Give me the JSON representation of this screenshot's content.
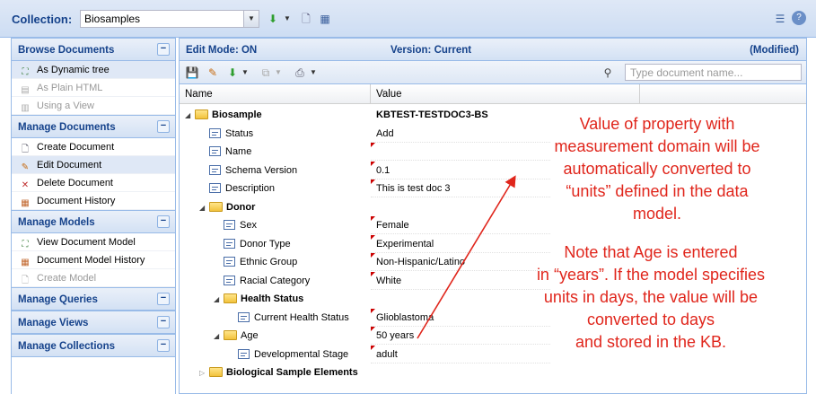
{
  "collection": {
    "label": "Collection:",
    "selected": "Biosamples"
  },
  "left_panel": {
    "sections": [
      {
        "title": "Browse Documents",
        "items": [
          {
            "label": "As Dynamic tree",
            "icon": "tree-icon",
            "state": "selected"
          },
          {
            "label": "As Plain HTML",
            "icon": "html-icon",
            "state": "disabled"
          },
          {
            "label": "Using a View",
            "icon": "view-icon",
            "state": "disabled"
          }
        ]
      },
      {
        "title": "Manage Documents",
        "items": [
          {
            "label": "Create Document",
            "icon": "new-document-icon",
            "state": "normal"
          },
          {
            "label": "Edit Document",
            "icon": "edit-document-icon",
            "state": "selected"
          },
          {
            "label": "Delete Document",
            "icon": "delete-document-icon",
            "state": "normal"
          },
          {
            "label": "Document History",
            "icon": "history-icon",
            "state": "normal"
          }
        ]
      },
      {
        "title": "Manage Models",
        "items": [
          {
            "label": "View Document Model",
            "icon": "tree-icon",
            "state": "normal"
          },
          {
            "label": "Document Model History",
            "icon": "history-icon",
            "state": "normal"
          },
          {
            "label": "Create Model",
            "icon": "new-document-icon",
            "state": "disabled"
          }
        ]
      },
      {
        "title": "Manage Queries",
        "items": []
      },
      {
        "title": "Manage Views",
        "items": []
      },
      {
        "title": "Manage Collections",
        "items": []
      }
    ],
    "toggle_symbol": "−"
  },
  "editor": {
    "mode": "Edit Mode: ON",
    "version": "Version: Current",
    "status": "(Modified)",
    "search_placeholder": "Type document name...",
    "columns": {
      "name": "Name",
      "value": "Value"
    },
    "rows": [
      {
        "name": "Biosample",
        "value": "KBTEST-TESTDOC3-BS",
        "kind": "folder",
        "depth": 0,
        "expanded": true,
        "bold_value": true
      },
      {
        "name": "Status",
        "value": "Add",
        "kind": "prop",
        "depth": 1,
        "dirty": false
      },
      {
        "name": "Name",
        "value": "",
        "kind": "prop",
        "depth": 1,
        "dirty": true
      },
      {
        "name": "Schema Version",
        "value": "0.1",
        "kind": "prop",
        "depth": 1,
        "dirty": true
      },
      {
        "name": "Description",
        "value": "This is test doc 3",
        "kind": "prop",
        "depth": 1,
        "dirty": true
      },
      {
        "name": "Donor",
        "value": "",
        "kind": "folder",
        "depth": 1,
        "expanded": true
      },
      {
        "name": "Sex",
        "value": "Female",
        "kind": "prop",
        "depth": 2,
        "dirty": true
      },
      {
        "name": "Donor Type",
        "value": "Experimental",
        "kind": "prop",
        "depth": 2,
        "dirty": true
      },
      {
        "name": "Ethnic Group",
        "value": "Non-Hispanic/Latino",
        "kind": "prop",
        "depth": 2,
        "dirty": true
      },
      {
        "name": "Racial Category",
        "value": "White",
        "kind": "prop",
        "depth": 2,
        "dirty": true
      },
      {
        "name": "Health Status",
        "value": "",
        "kind": "folder",
        "depth": 2,
        "expanded": true
      },
      {
        "name": "Current Health Status",
        "value": "Glioblastoma",
        "kind": "prop",
        "depth": 3,
        "dirty": true
      },
      {
        "name": "Age",
        "value": "50 years",
        "kind": "folder",
        "depth": 2,
        "expanded": true,
        "dirty": true
      },
      {
        "name": "Developmental Stage",
        "value": "adult",
        "kind": "prop",
        "depth": 3,
        "dirty": true
      },
      {
        "name": "Biological Sample Elements",
        "value": "",
        "kind": "folder",
        "depth": 1,
        "expanded": false
      }
    ]
  },
  "annotation": {
    "color": "#e0261c",
    "text1_lines": [
      "Value of property with",
      "measurement domain will be",
      "automatically converted to",
      "“units” defined in the data",
      "model."
    ],
    "text2_lines": [
      "Note that Age is entered",
      "in “years”. If the model specifies",
      "units in days, the value will be",
      "converted to days",
      "and stored in the KB."
    ]
  }
}
